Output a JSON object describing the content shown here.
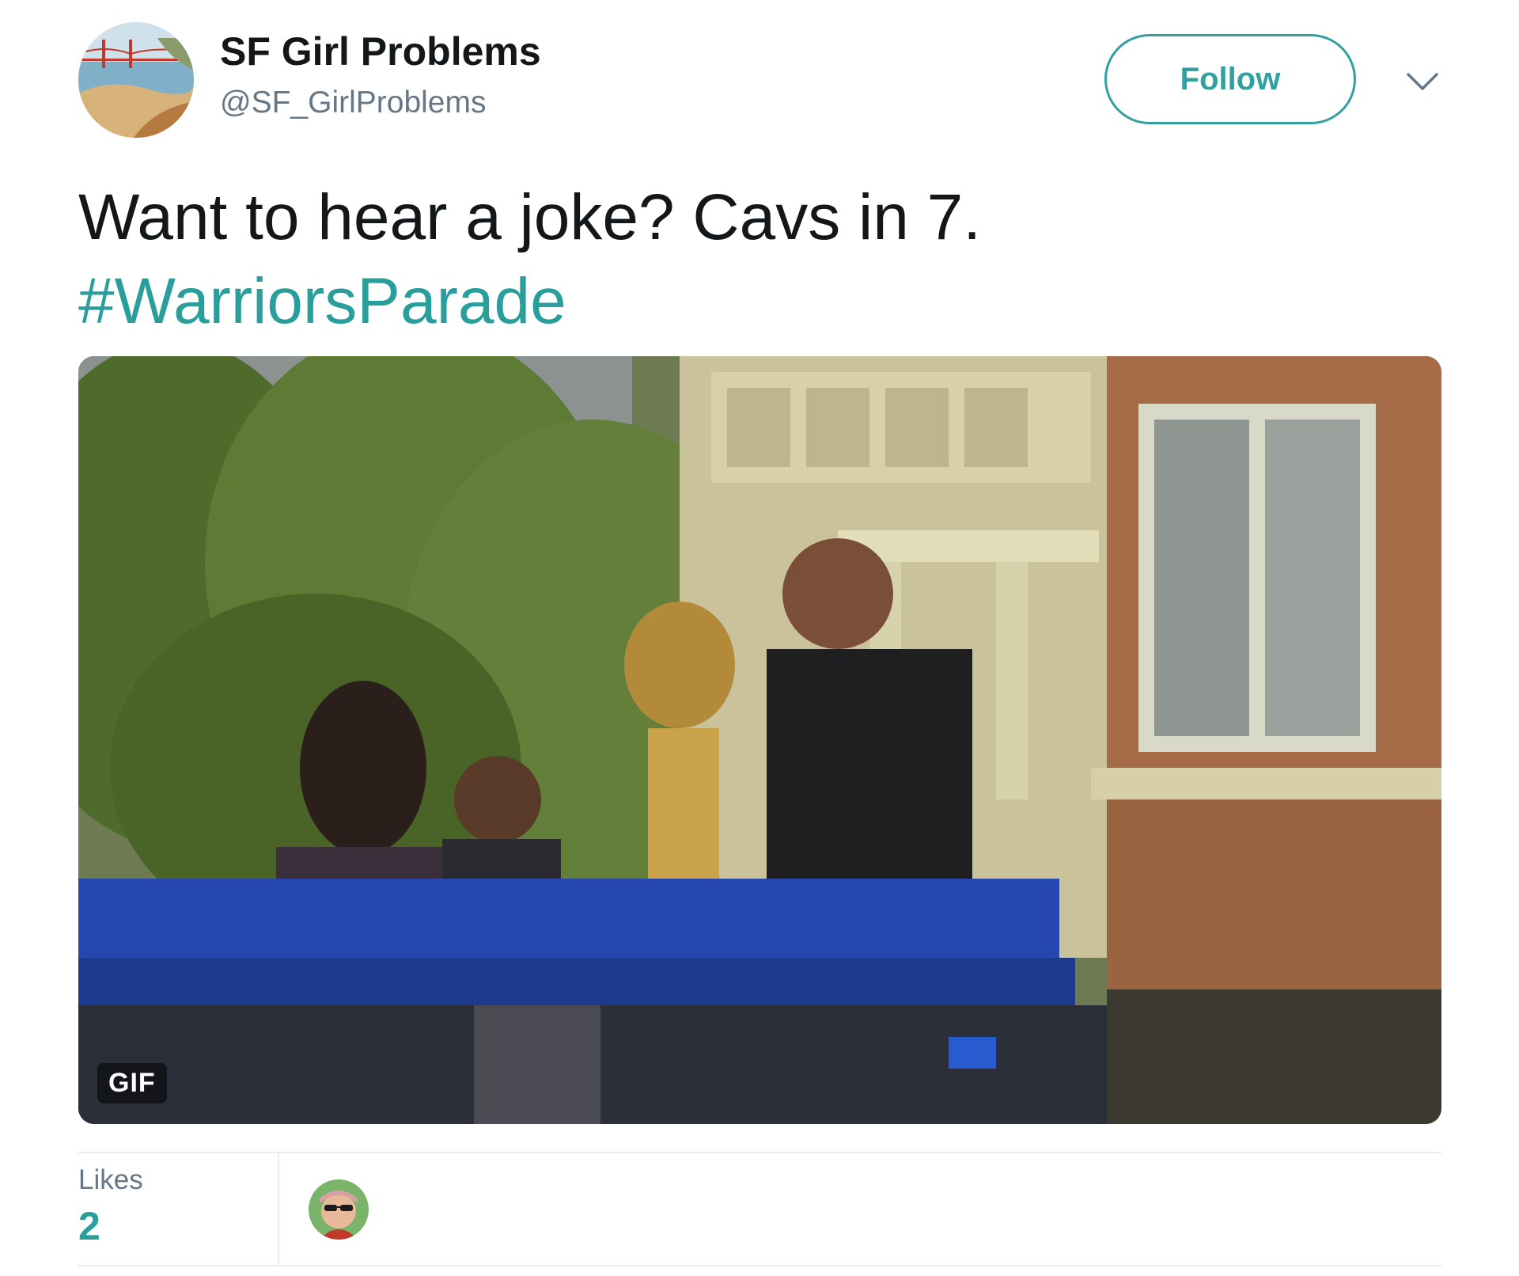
{
  "author": {
    "display_name": "SF Girl Problems",
    "handle": "@SF_GirlProblems",
    "avatar_icon": "golden-gate-beach-avatar"
  },
  "header": {
    "follow_label": "Follow",
    "menu_icon": "chevron-down-icon"
  },
  "tweet": {
    "text": "Want to hear a joke? Cavs in 7.",
    "hashtag": "#WarriorsParade"
  },
  "media": {
    "type": "gif",
    "badge": "GIF"
  },
  "stats": {
    "likes_label": "Likes",
    "likes_count": "2"
  },
  "colors": {
    "accent": "#2a9e9a",
    "text": "#14171a",
    "secondary": "#657786",
    "divider": "#e6ecf0"
  }
}
